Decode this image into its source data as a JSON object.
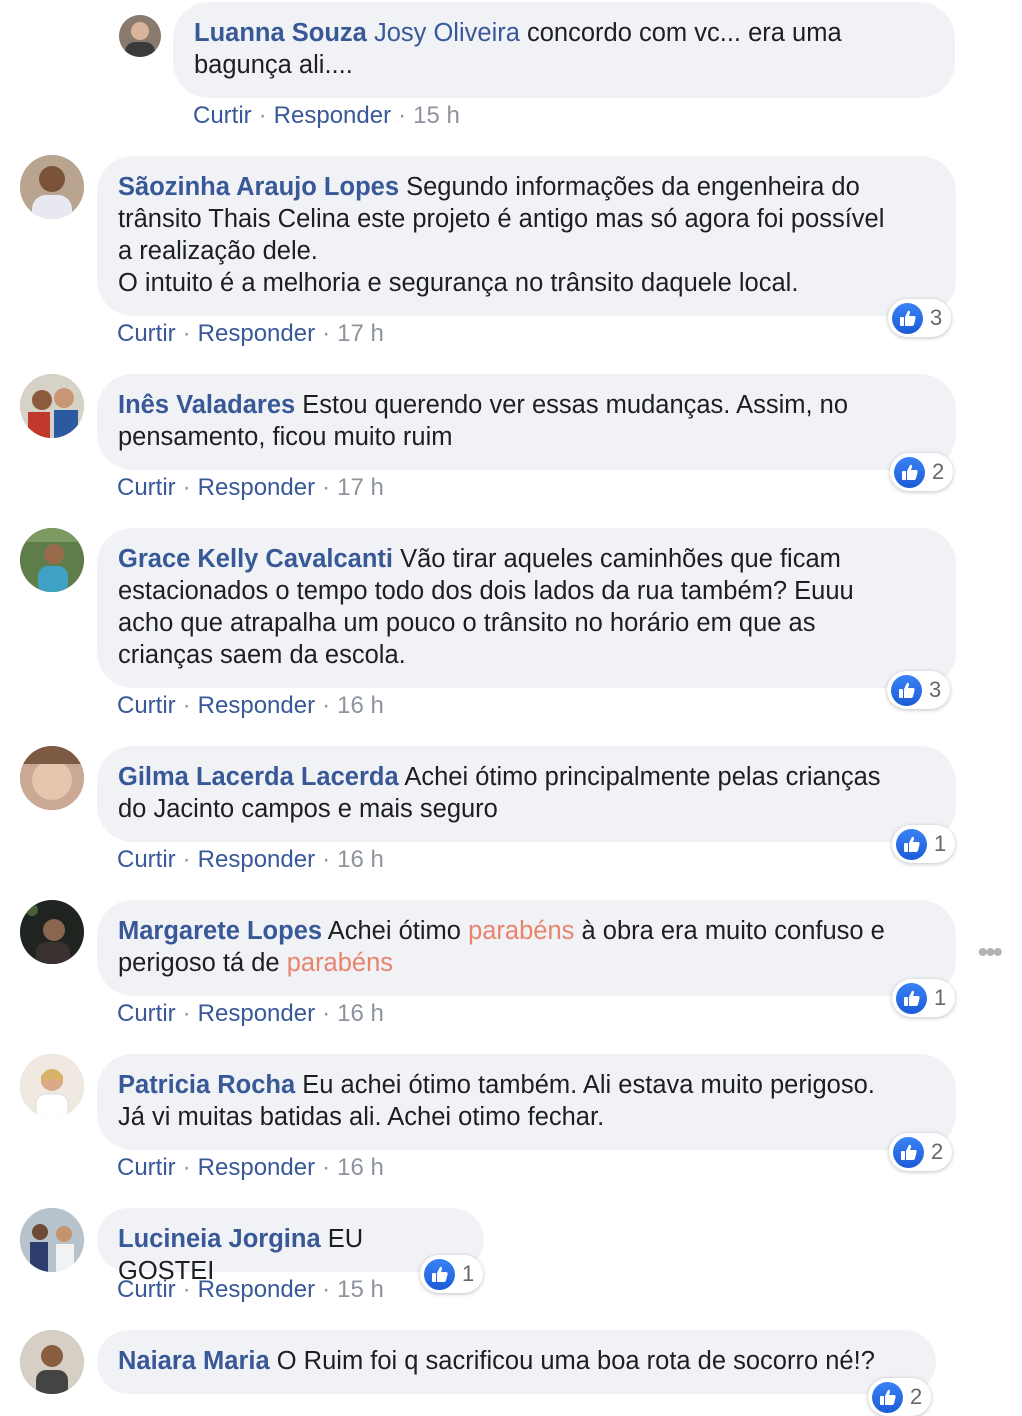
{
  "actions": {
    "like": "Curtir",
    "reply": "Responder"
  },
  "comments": [
    {
      "author": "Luanna Souza",
      "mention": "Josy Oliveira",
      "text1": " concordo com vc... era uma",
      "text2": "bagunça ali....",
      "time": "15 h"
    },
    {
      "author": "Sãozinha Araujo Lopes",
      "text1": " Segundo informações da engenheira do",
      "text2": "trânsito Thais Celina este projeto é antigo mas só agora foi possível",
      "text3": "a realização dele.",
      "text4": "O intuito é a melhoria e segurança no trânsito daquele local.",
      "time": "17 h",
      "likes": "3"
    },
    {
      "author": "Inês Valadares",
      "text1": " Estou querendo ver essas mudanças. Assim, no",
      "text2": "pensamento, ficou muito ruim",
      "time": "17 h",
      "likes": "2"
    },
    {
      "author": "Grace Kelly Cavalcanti",
      "text1": " Vão tirar aqueles caminhões que ficam",
      "text2": "estacionados o tempo todo dos dois lados da rua também? Euuu",
      "text3": "acho que atrapalha um pouco o trânsito no horário em que as",
      "text4": "crianças saem da escola.",
      "time": "16 h",
      "likes": "3"
    },
    {
      "author": "Gilma Lacerda Lacerda",
      "text1": " Achei ótimo principalmente pelas crianças",
      "text2": "do Jacinto campos e mais seguro",
      "time": "16 h",
      "likes": "1"
    },
    {
      "author": "Margarete Lopes",
      "text1a": " Achei ótimo ",
      "tag": "parabéns",
      "text1b": " à obra era muito confuso e",
      "text2a": "perigoso tá de ",
      "time": "16 h",
      "likes": "1"
    },
    {
      "author": "Patricia Rocha",
      "text1": " Eu achei ótimo também. Ali estava muito perigoso.",
      "text2": "Já vi muitas batidas ali. Achei otimo fechar.",
      "time": "16 h",
      "likes": "2"
    },
    {
      "author": "Lucineia Jorgina",
      "text1": " EU GOSTEI",
      "time": "15 h",
      "likes": "1"
    },
    {
      "author": "Naiara Maria",
      "text1": " O Ruim foi q sacrificou uma boa rota de socorro né!?",
      "likes": "2"
    }
  ],
  "more_menu": "•••"
}
